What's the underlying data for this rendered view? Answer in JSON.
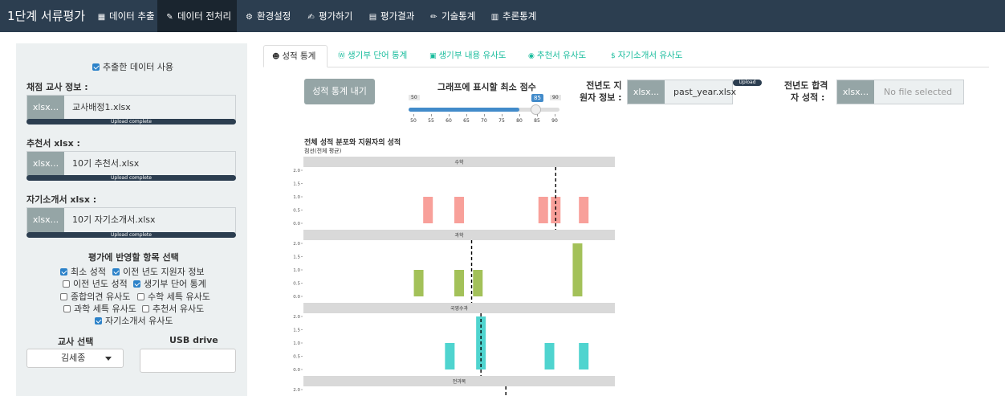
{
  "navbar": {
    "brand": "1단계 서류평가",
    "items": [
      {
        "label": "데이터 추출",
        "icon": "database-icon",
        "glyph": "▦"
      },
      {
        "label": "데이터 전처리",
        "icon": "magic-wand-icon",
        "glyph": "✎",
        "active": true
      },
      {
        "label": "환경설정",
        "icon": "gears-icon",
        "glyph": "⚙"
      },
      {
        "label": "평가하기",
        "icon": "edit-icon",
        "glyph": "✍"
      },
      {
        "label": "평가결과",
        "icon": "file-icon",
        "glyph": "▤"
      },
      {
        "label": "기술통계",
        "icon": "pencil-icon",
        "glyph": "✏"
      },
      {
        "label": "추론통계",
        "icon": "bar-chart-icon",
        "glyph": "▥"
      }
    ]
  },
  "sidebar": {
    "use_extracted": "추출한 데이터 사용",
    "use_extracted_checked": true,
    "file_button": "xlsx...",
    "teacher_label": "채점 교사 정보 :",
    "teacher_file": "교사배정1.xlsx",
    "rec_label": "추천서 xlsx :",
    "rec_file": "10기 추천서.xlsx",
    "intro_label": "자기소개서 xlsx :",
    "intro_file": "10기 자기소개서.xlsx",
    "upload_complete": "Upload complete",
    "criteria_title": "평가에 반영할 항목 선택",
    "criteria": [
      {
        "label": "최소 성적",
        "checked": true
      },
      {
        "label": "이전 년도 지원자 정보",
        "checked": true
      },
      {
        "label": "이전 년도 성적",
        "checked": false
      },
      {
        "label": "생기부 단어 통계",
        "checked": true
      },
      {
        "label": "종합의견 유사도",
        "checked": false
      },
      {
        "label": "수학 세특 유사도",
        "checked": false
      },
      {
        "label": "과학 세특 유사도",
        "checked": false
      },
      {
        "label": "추천서 유사도",
        "checked": false
      },
      {
        "label": "자기소개서 유사도",
        "checked": true
      }
    ],
    "teacher_select_label": "교사 선택",
    "teacher_selected": "김세종",
    "usb_label": "USB drive"
  },
  "tabs": [
    {
      "label": "성적 통계",
      "icon": "users-icon",
      "glyph": "☻",
      "active": true
    },
    {
      "label": "생기부 단어 통계",
      "icon": "wordpress-icon",
      "glyph": "Ⓦ"
    },
    {
      "label": "생기부 내용 유사도",
      "icon": "save-icon",
      "glyph": "▣"
    },
    {
      "label": "추천서 유사도",
      "icon": "eye-icon",
      "glyph": "◉"
    },
    {
      "label": "자기소개서 유사도",
      "icon": "dollar-icon",
      "glyph": "$"
    }
  ],
  "controls": {
    "stats_button": "성적 통계 내기",
    "slider_label": "그래프에 표시할 최소 점수",
    "slider_min": 50,
    "slider_max": 90,
    "slider_value": 85,
    "slider_ticks": [
      "50",
      "55",
      "60",
      "65",
      "70",
      "75",
      "80",
      "85",
      "90"
    ],
    "prev_info_label_1": "전년도 지",
    "prev_info_label_2": "원자 정보 :",
    "prev_info_button": "xlsx...",
    "prev_info_file": "past_year.xlsx",
    "upload_pill": "Upload",
    "prev_score_label_1": "전년도 합격",
    "prev_score_label_2": "자 성적 :",
    "prev_score_button": "xlsx...",
    "prev_score_placeholder": "No file selected"
  },
  "chart_data": {
    "type": "bar",
    "title": "전체 성적 분포와 지원자의 성적",
    "subtitle": "점선(전체 평균)",
    "y_ticks": [
      "0.0",
      "0.5",
      "1.0",
      "1.5",
      "2.0"
    ],
    "ylim": [
      0,
      2
    ],
    "facets": [
      {
        "name": "수학",
        "color": "#f8a09a",
        "bars": [
          {
            "x": 0.4,
            "count": 1
          },
          {
            "x": 0.5,
            "count": 1
          },
          {
            "x": 0.77,
            "count": 1
          },
          {
            "x": 0.81,
            "count": 1
          },
          {
            "x": 0.9,
            "count": 1
          }
        ],
        "mean": 0.81
      },
      {
        "name": "과학",
        "color": "#a3c159",
        "bars": [
          {
            "x": 0.37,
            "count": 1
          },
          {
            "x": 0.5,
            "count": 1
          },
          {
            "x": 0.56,
            "count": 1
          },
          {
            "x": 0.88,
            "count": 2
          }
        ],
        "mean": 0.54
      },
      {
        "name": "국영수과",
        "color": "#4fd4cf",
        "bars": [
          {
            "x": 0.47,
            "count": 1
          },
          {
            "x": 0.57,
            "count": 2
          },
          {
            "x": 0.79,
            "count": 1
          },
          {
            "x": 0.9,
            "count": 1
          }
        ],
        "mean": 0.57
      },
      {
        "name": "전과목",
        "color": "#a3a3e8",
        "bars": [],
        "mean": 0.65
      }
    ]
  }
}
